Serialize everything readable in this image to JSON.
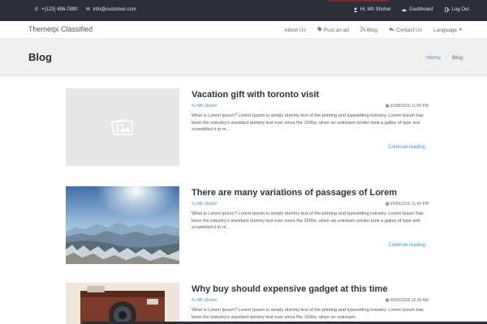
{
  "topbar": {
    "phone": "+(123) 456-7890",
    "email": "info@customer.com",
    "greeting": "Hi, Mh Shohel",
    "dashboard": "Dashboard",
    "logout": "Log Out"
  },
  "navbar": {
    "brand": "Themeqx Classified",
    "items": [
      "About Us",
      "Post an ad",
      "Blog",
      "Contact Us",
      "Language"
    ]
  },
  "page": {
    "title": "Blog",
    "breadcrumb_home": "Home",
    "breadcrumb_sep": "/",
    "breadcrumb_current": "Blog"
  },
  "posts": [
    {
      "title": "Vacation gift with toronto visit",
      "by": "By",
      "author": "Mh Shohel",
      "date": "31/08/2016 11:05 PM",
      "excerpt": "What is Lorem Ipsum? Lorem Ipsum is simply dummy text of the printing and typesetting industry. Lorem Ipsum has been the industry's standard dummy text ever since the 1500s, when an unknown printer took a galley of type and scrambled it to m...",
      "more": "Continue reading"
    },
    {
      "title": "There are many variations of passages of Lorem",
      "by": "By",
      "author": "Mh Shohel",
      "date": "02/09/2016 11:44 PM",
      "excerpt": "What is Lorem Ipsum? Lorem Ipsum is simply dummy text of the printing and typesetting industry. Lorem Ipsum has been the industry's standard dummy text ever since the 1500s, when an unknown printer took a galley of type and scrambled it to m...",
      "more": "Continue reading"
    },
    {
      "title": "Why buy should expensive gadget at this time",
      "by": "By",
      "author": "Mh Shohel",
      "date": "06/09/2016 12:36 AM",
      "excerpt": "What is Lorem Ipsum? Lorem Ipsum is simply dummy text of the printing and typesetting industry. Lorem Ipsum has been the industry's standard dummy text ever since the 1500s, when an unknown",
      "more": ""
    }
  ],
  "icons": {
    "phone": "phone-icon",
    "email": "envelope-icon",
    "user": "user-icon",
    "dashboard": "dashboard-icon",
    "logout": "logout-icon",
    "post_ad": "tag-icon",
    "blog": "rss-icon",
    "contact": "reply-icon",
    "date": "calendar-icon",
    "placeholder": "image-placeholder-icon"
  },
  "colors": {
    "topbar_bg": "#2b2f39",
    "link": "#3a8fcf",
    "header_bg": "#f0f0f0"
  }
}
